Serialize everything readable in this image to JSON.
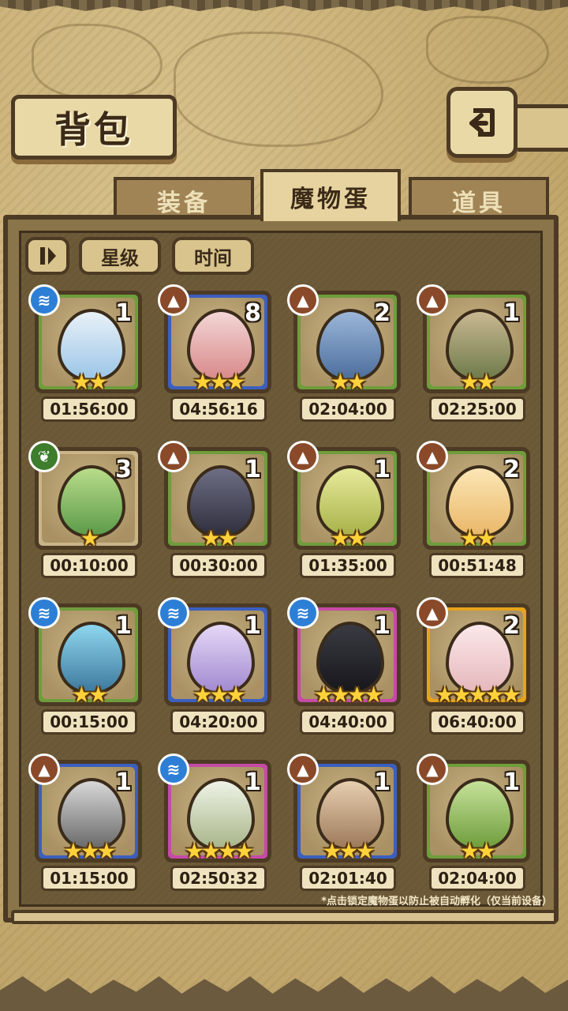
{
  "header": {
    "title": "背包",
    "back_icon": "return-arrow-icon"
  },
  "tabs": [
    {
      "label": "装备",
      "active": false
    },
    {
      "label": "魔物蛋",
      "active": true
    },
    {
      "label": "道具",
      "active": false
    }
  ],
  "filters": {
    "sort_icon": "sort-toggle-icon",
    "star_label": "星级",
    "time_label": "时间"
  },
  "colors": {
    "water": "#2d7fd6",
    "earth": "#8a4a2a",
    "grass": "#3d7d2d"
  },
  "eggs": [
    {
      "element": "water",
      "count": "1",
      "stars": "★★",
      "timer": "01:56:00",
      "rarity": "green"
    },
    {
      "element": "earth",
      "count": "8",
      "stars": "★★★",
      "timer": "04:56:16",
      "rarity": "blue"
    },
    {
      "element": "earth",
      "count": "2",
      "stars": "★★",
      "timer": "02:04:00",
      "rarity": "green"
    },
    {
      "element": "earth",
      "count": "1",
      "stars": "★★",
      "timer": "02:25:00",
      "rarity": "green"
    },
    {
      "element": "grass",
      "count": "3",
      "stars": "★",
      "timer": "00:10:00",
      "rarity": "plain"
    },
    {
      "element": "earth",
      "count": "1",
      "stars": "★★",
      "timer": "00:30:00",
      "rarity": "green"
    },
    {
      "element": "earth",
      "count": "1",
      "stars": "★★",
      "timer": "01:35:00",
      "rarity": "green"
    },
    {
      "element": "earth",
      "count": "2",
      "stars": "★★",
      "timer": "00:51:48",
      "rarity": "green"
    },
    {
      "element": "water",
      "count": "1",
      "stars": "★★",
      "timer": "00:15:00",
      "rarity": "green"
    },
    {
      "element": "water",
      "count": "1",
      "stars": "★★★",
      "timer": "04:20:00",
      "rarity": "blue"
    },
    {
      "element": "water",
      "count": "1",
      "stars": "★★★★",
      "timer": "04:40:00",
      "rarity": "pink"
    },
    {
      "element": "earth",
      "count": "2",
      "stars": "★★★★★",
      "timer": "06:40:00",
      "rarity": "gold"
    },
    {
      "element": "earth",
      "count": "1",
      "stars": "★★★",
      "timer": "01:15:00",
      "rarity": "blue"
    },
    {
      "element": "water",
      "count": "1",
      "stars": "★★★★",
      "timer": "02:50:32",
      "rarity": "pink"
    },
    {
      "element": "earth",
      "count": "1",
      "stars": "★★★",
      "timer": "02:01:40",
      "rarity": "blue"
    },
    {
      "element": "earth",
      "count": "1",
      "stars": "★★",
      "timer": "02:04:00",
      "rarity": "green"
    }
  ],
  "footer_note": "*点击锁定魔物蛋以防止被自动孵化（仅当前设备）"
}
